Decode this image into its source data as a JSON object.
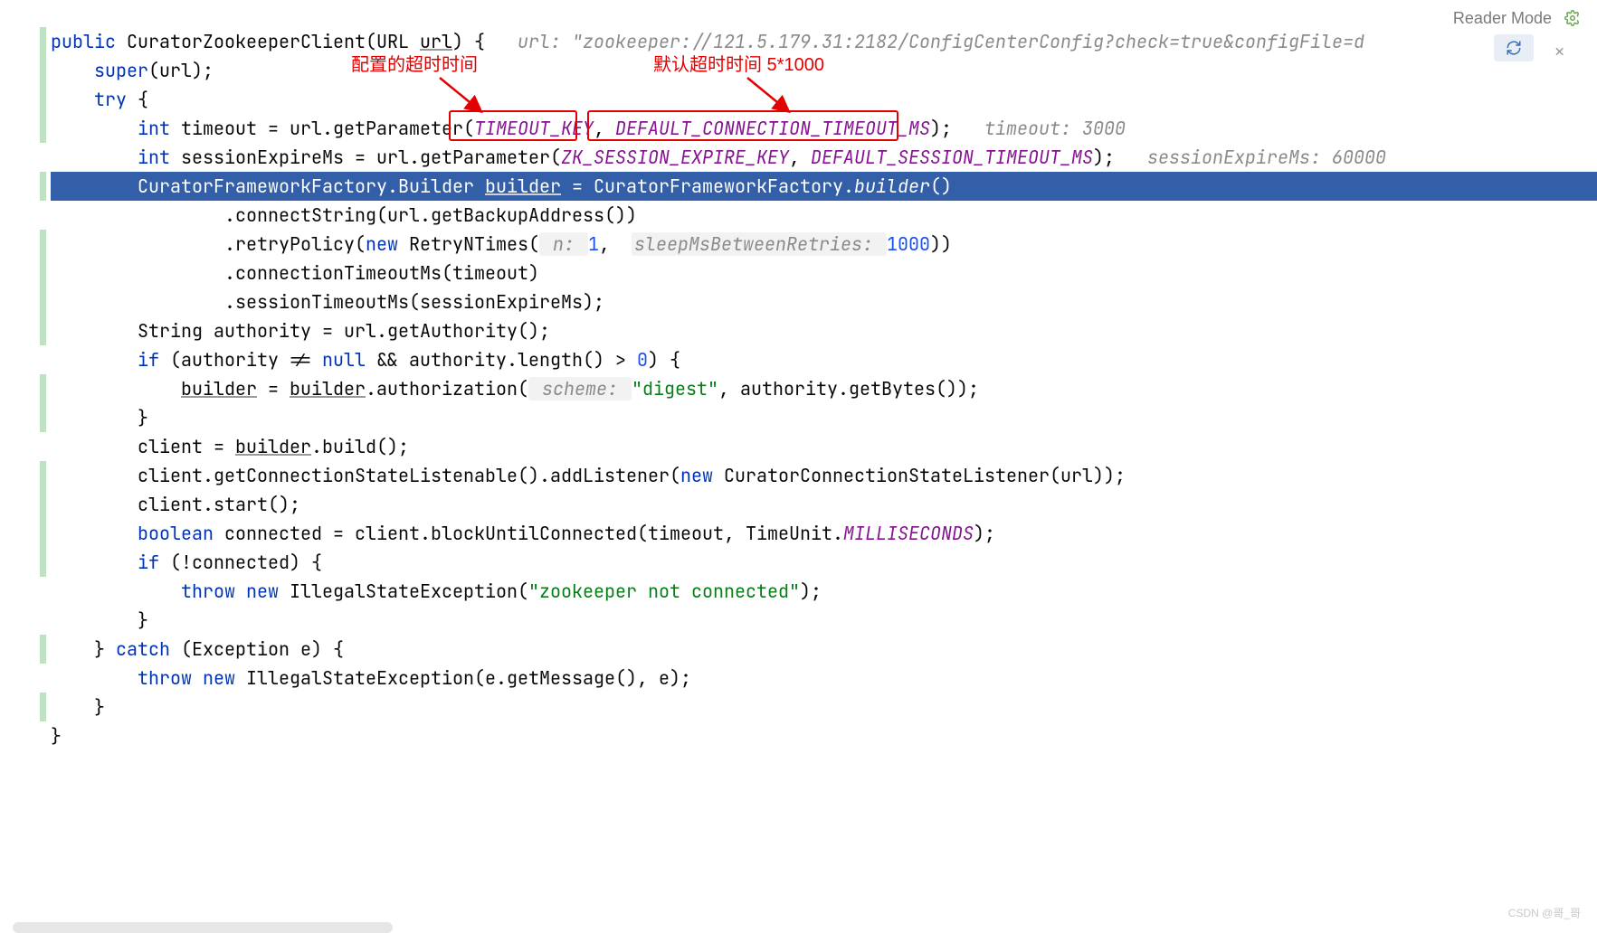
{
  "header": {
    "reader_mode": "Reader Mode",
    "gear_icon": "gear-icon",
    "refresh_icon": "refresh-icon",
    "close_icon": "close-icon"
  },
  "annotations": {
    "left_label": "配置的超时时间",
    "right_label": "默认超时时间 5*1000",
    "box1_text": "TIMEOUT_KEY",
    "box2_text": "DEFAULT_CONNECTION_TIMEOUT_MS"
  },
  "code": {
    "l1": {
      "kw_public": "public",
      "class": "CuratorZookeeperClient",
      "params": "(URL ",
      "param_name": "url",
      "close": ") {",
      "hint_label": "url: ",
      "hint_val": "\"zookeeper://121.5.179.31:2182/ConfigCenterConfig?check=true&configFile=d"
    },
    "l2": {
      "kw_super": "super",
      "rest": "(url);"
    },
    "l3": {
      "kw_try": "try",
      "rest": " {"
    },
    "l4": {
      "kw_int": "int",
      "var": " timeout = url.getParameter(",
      "p1": "TIMEOUT_KEY",
      "comma": ", ",
      "p2": "DEFAULT_CONNECTION_TIMEOUT_MS",
      "close": ");",
      "hint": "timeout: 3000"
    },
    "l5": {
      "kw_int": "int",
      "var": " sessionExpireMs = url.getParameter(",
      "p1": "ZK_SESSION_EXPIRE_KEY",
      "comma": ", ",
      "p2": "DEFAULT_SESSION_TIMEOUT_MS",
      "close": ");",
      "hint": "sessionExpireMs: 60000"
    },
    "l6": {
      "a": "CuratorFrameworkFactory.Builder ",
      "b": "builder",
      "c": " = CuratorFrameworkFactory.",
      "d": "builder",
      "e": "()"
    },
    "l7": ".connectString(url.getBackupAddress())",
    "l8": {
      "a": ".retryPolicy(",
      "kw_new": "new",
      "b": " RetryNTimes(",
      "h1": " n: ",
      "v1": "1",
      "c": ",",
      "h2": "sleepMsBetweenRetries: ",
      "v2": "1000",
      "d": "))"
    },
    "l9": ".connectionTimeoutMs(timeout)",
    "l10": ".sessionTimeoutMs(sessionExpireMs);",
    "l11": {
      "a": "String authority = url.getAuthority();"
    },
    "l12": {
      "kw_if": "if",
      "a": " (authority != ",
      "kw_null": "null",
      "b": " && authority.length() > ",
      "num": "0",
      "c": ") {"
    },
    "l13": {
      "a": "builder",
      "b": " = ",
      "c": "builder",
      "d": ".authorization(",
      "h": " scheme: ",
      "s": "\"digest\"",
      "e": ", authority.getBytes());"
    },
    "l14": "}",
    "l15": {
      "a": "client = ",
      "b": "builder",
      "c": ".build();"
    },
    "l16": {
      "a": "client.getConnectionStateListenable().addListener(",
      "kw_new": "new",
      "b": " CuratorConnectionStateListener(url));"
    },
    "l17": "client.start();",
    "l18": {
      "kw": "boolean",
      "a": " connected = client.blockUntilConnected(timeout, TimeUnit.",
      "b": "MILLISECONDS",
      "c": ");"
    },
    "l19": {
      "kw_if": "if",
      "a": " (!connected) {"
    },
    "l20": {
      "kw_throw": "throw",
      "sp": " ",
      "kw_new": "new",
      "a": " IllegalStateException(",
      "s": "\"zookeeper not connected\"",
      "b": ");"
    },
    "l21": "}",
    "l22": {
      "a": "} ",
      "kw_catch": "catch",
      "b": " (Exception e) {"
    },
    "l23": {
      "kw_throw": "throw",
      "sp": " ",
      "kw_new": "new",
      "a": " IllegalStateException(e.getMessage(), e);"
    },
    "l24": "}",
    "l25": "}"
  },
  "watermark": "CSDN @哥_哥"
}
